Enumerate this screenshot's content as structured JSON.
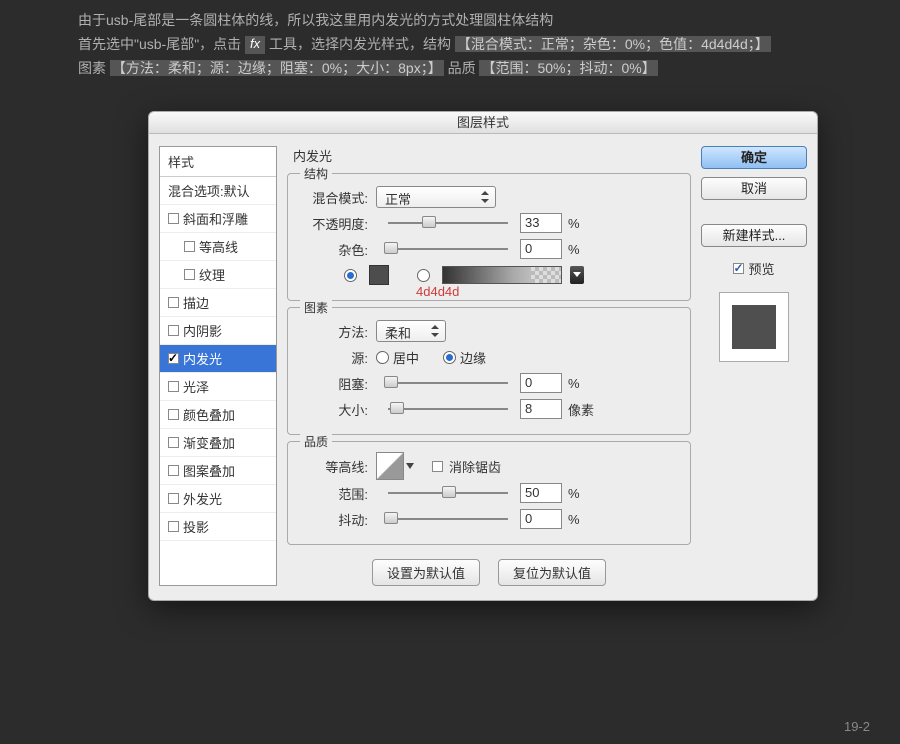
{
  "intro": {
    "line1": "由于usb-尾部是一条圆柱体的线，所以我这里用内发光的方式处理圆柱体结构",
    "line2a": "首先选中\"usb-尾部\"，点击",
    "line2b": "工具，选择内发光样式，结构",
    "hl1": "【混合模式：正常；杂色：0%；色值：4d4d4d；】",
    "line3a": "图素",
    "hl2": "【方法：柔和；源：边缘；阻塞：0%；大小：8px；】",
    "line3b": "品质",
    "hl3": "【范围：50%；抖动：0%】"
  },
  "dialog": {
    "title": "图层样式",
    "styles_header": "样式",
    "blend_default": "混合选项:默认",
    "items": [
      "斜面和浮雕",
      "等高线",
      "纹理",
      "描边",
      "内阴影",
      "内发光",
      "光泽",
      "颜色叠加",
      "渐变叠加",
      "图案叠加",
      "外发光",
      "投影"
    ],
    "panel_title": "内发光",
    "group_structure": "结构",
    "group_element": "图素",
    "group_quality": "品质",
    "labels": {
      "blend_mode": "混合模式:",
      "opacity": "不透明度:",
      "noise": "杂色:",
      "method": "方法:",
      "source": "源:",
      "choke": "阻塞:",
      "size": "大小:",
      "contour": "等高线:",
      "antialias": "消除锯齿",
      "range": "范围:",
      "jitter": "抖动:",
      "center": "居中",
      "edge": "边缘"
    },
    "values": {
      "blend_mode": "正常",
      "opacity": "33",
      "noise": "0",
      "method": "柔和",
      "choke": "0",
      "size": "8",
      "range": "50",
      "jitter": "0",
      "percent": "%",
      "pixel": "像素"
    },
    "color_note": "4d4d4d",
    "buttons": {
      "set_default": "设置为默认值",
      "reset_default": "复位为默认值",
      "ok": "确定",
      "cancel": "取消",
      "new_style": "新建样式...",
      "preview": "预览"
    }
  },
  "page_num": "19-2"
}
